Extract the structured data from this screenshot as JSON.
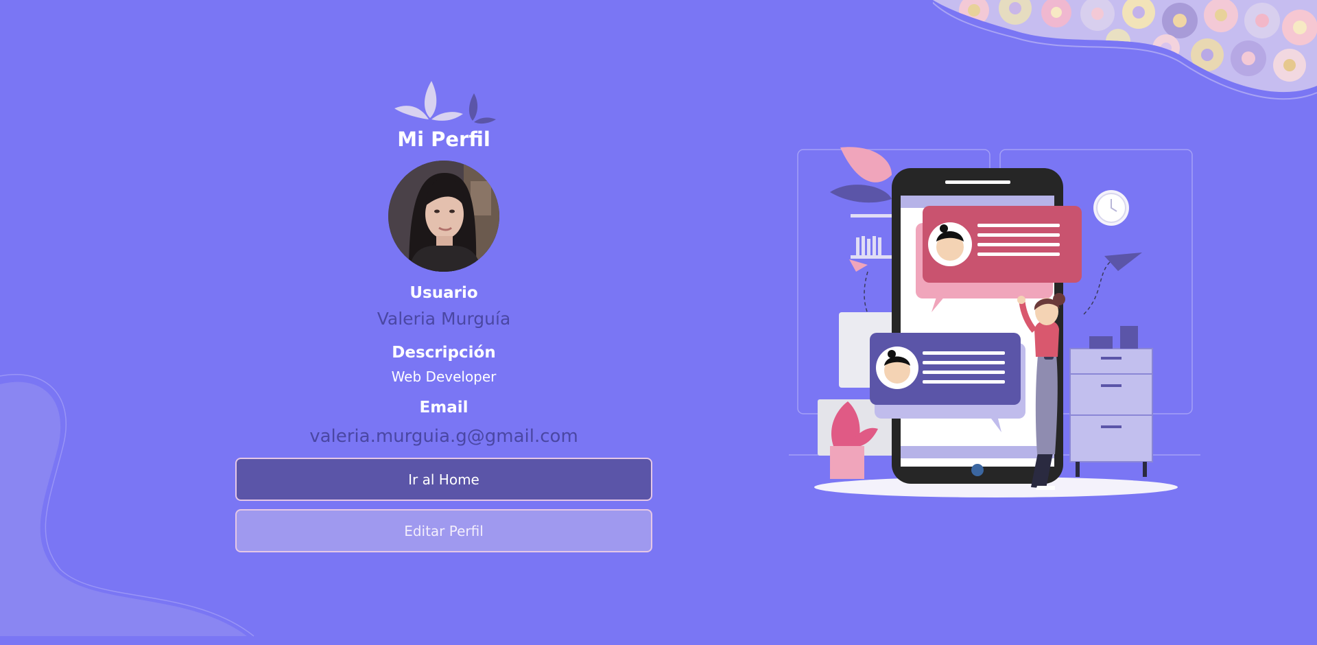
{
  "page": {
    "title": "Mi Perfil",
    "colors": {
      "background": "#7a76f4",
      "accent_dark": "#5b55a8",
      "accent_light": "#9f99ef",
      "text_dark": "#4a47a3"
    }
  },
  "profile": {
    "user_label": "Usuario",
    "user_name": "Valeria Murguía",
    "description_label": "Descripción",
    "description": "Web Developer",
    "email_label": "Email",
    "email": "valeria.murguia.g@gmail.com"
  },
  "actions": {
    "home_label": "Ir al Home",
    "edit_label": "Editar Perfil"
  },
  "icons": {
    "logo": "leaves-logo-icon",
    "avatar": "profile-photo",
    "illustration": "chat-phone-illustration"
  }
}
